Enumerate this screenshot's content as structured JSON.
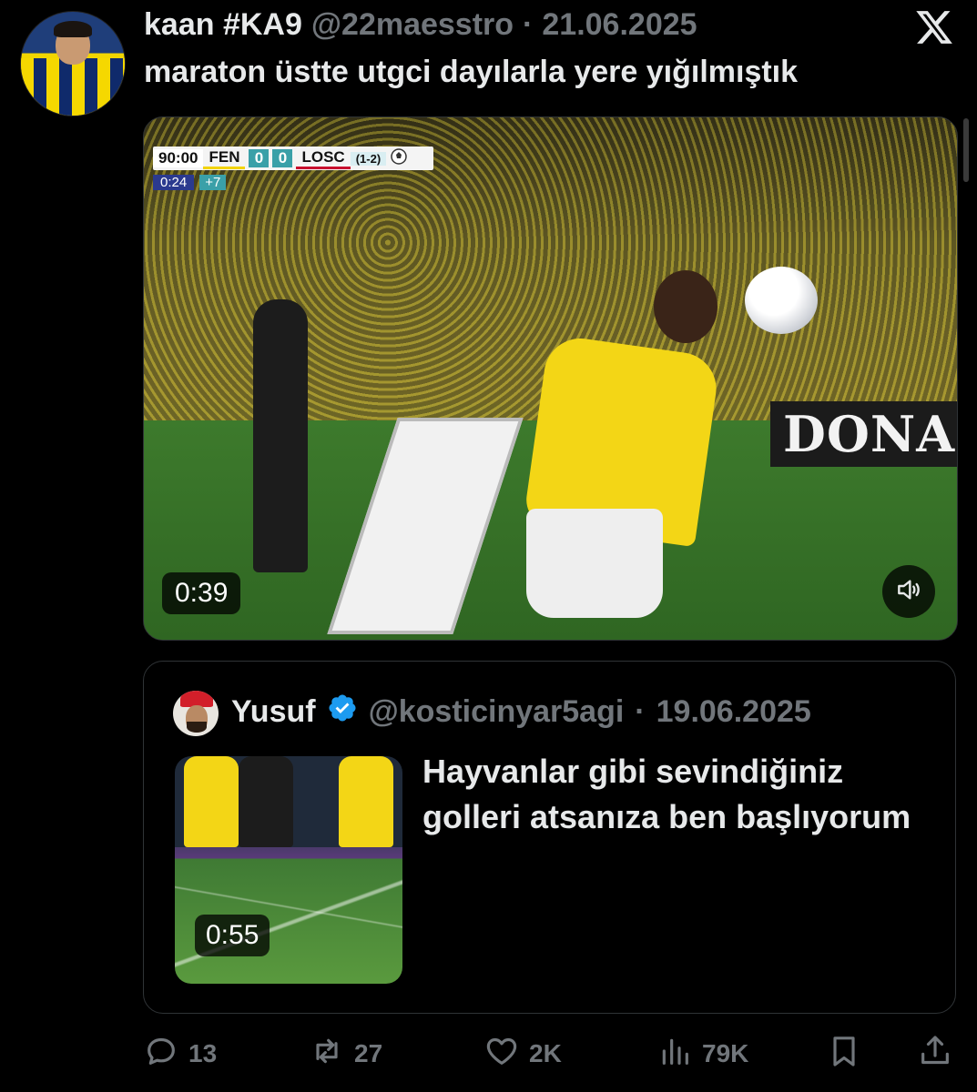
{
  "tweet": {
    "display_name": "kaan #KA9",
    "handle": "@22maesstro",
    "separator": "·",
    "date": "21.06.2025",
    "text": "maraton üstte utgci dayılarla yere yığılmıştık"
  },
  "video": {
    "scoreboard": {
      "match_time": "90:00",
      "home_team": "FEN",
      "home_score": "0",
      "away_score": "0",
      "away_team": "LOSC",
      "aggregate": "(1-2)",
      "clock": "0:24",
      "added_time": "+7"
    },
    "ad_board_text": "DONA",
    "duration": "0:39",
    "sound_icon": "speaker-muted-icon"
  },
  "quote": {
    "display_name": "Yusuf",
    "handle": "@kosticinyar5agi",
    "separator": "·",
    "date": "19.06.2025",
    "text": "Hayvanlar gibi sevindiğiniz golleri atsanıza ben başlıyorum",
    "media_duration": "0:55"
  },
  "actions": {
    "replies": "13",
    "reposts": "27",
    "likes": "2K",
    "views": "79K"
  },
  "colors": {
    "background": "#000000",
    "text_primary": "#e7e9ea",
    "text_secondary": "#71767b",
    "border": "#2f3336",
    "verified_blue": "#1d9bf0",
    "fener_yellow": "#f3d616"
  }
}
